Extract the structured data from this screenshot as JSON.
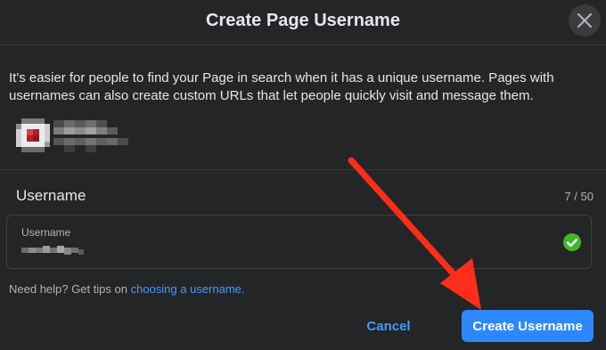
{
  "dialog": {
    "title": "Create Page Username",
    "close_icon": "close-icon"
  },
  "description": "It's easier for people to find your Page in search when it has a unique username. Pages with usernames can also create custom URLs that let people quickly visit and message them.",
  "page_profile": {
    "avatar_icon": "page-avatar-pixelated",
    "name_icon": "pixelated-page-name"
  },
  "username_section": {
    "heading": "Username",
    "char_count": "7 / 50",
    "field_label": "Username",
    "value_icon": "pixelated-username-value",
    "status_icon": "check-circle-icon",
    "status_color": "#42b72a"
  },
  "help": {
    "text": "Need help? Get tips on ",
    "link_text": "choosing a username."
  },
  "buttons": {
    "cancel": "Cancel",
    "create": "Create Username"
  },
  "colors": {
    "background": "#242526",
    "accent": "#2d88ff",
    "link": "#4599ff",
    "annotation_arrow": "#ff2d1a"
  }
}
